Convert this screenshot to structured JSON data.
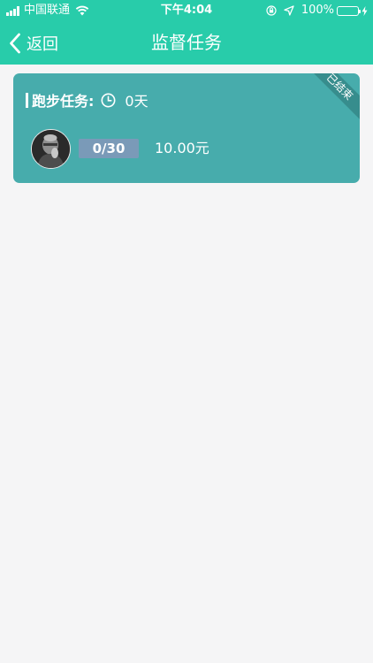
{
  "status_bar": {
    "carrier": "中国联通",
    "time": "下午4:04",
    "battery": "100%",
    "battery_level": 1.0
  },
  "nav": {
    "back_label": "返回",
    "title": "监督任务"
  },
  "task": {
    "title": "跑步任务:",
    "days": "0天",
    "status_ribbon": "已结束",
    "progress": "0/30",
    "amount": "10.00元"
  },
  "colors": {
    "header": "#28ccaa",
    "card": "#47acac",
    "ribbon": "#378d8d",
    "progress_badge": "#7a9ab8",
    "page_bg": "#f5f5f6"
  },
  "icons": [
    "signal-icon",
    "wifi-icon",
    "rotation-lock-icon",
    "location-arrow-icon",
    "battery-icon",
    "charging-bolt-icon",
    "chevron-left-icon",
    "clock-icon"
  ]
}
